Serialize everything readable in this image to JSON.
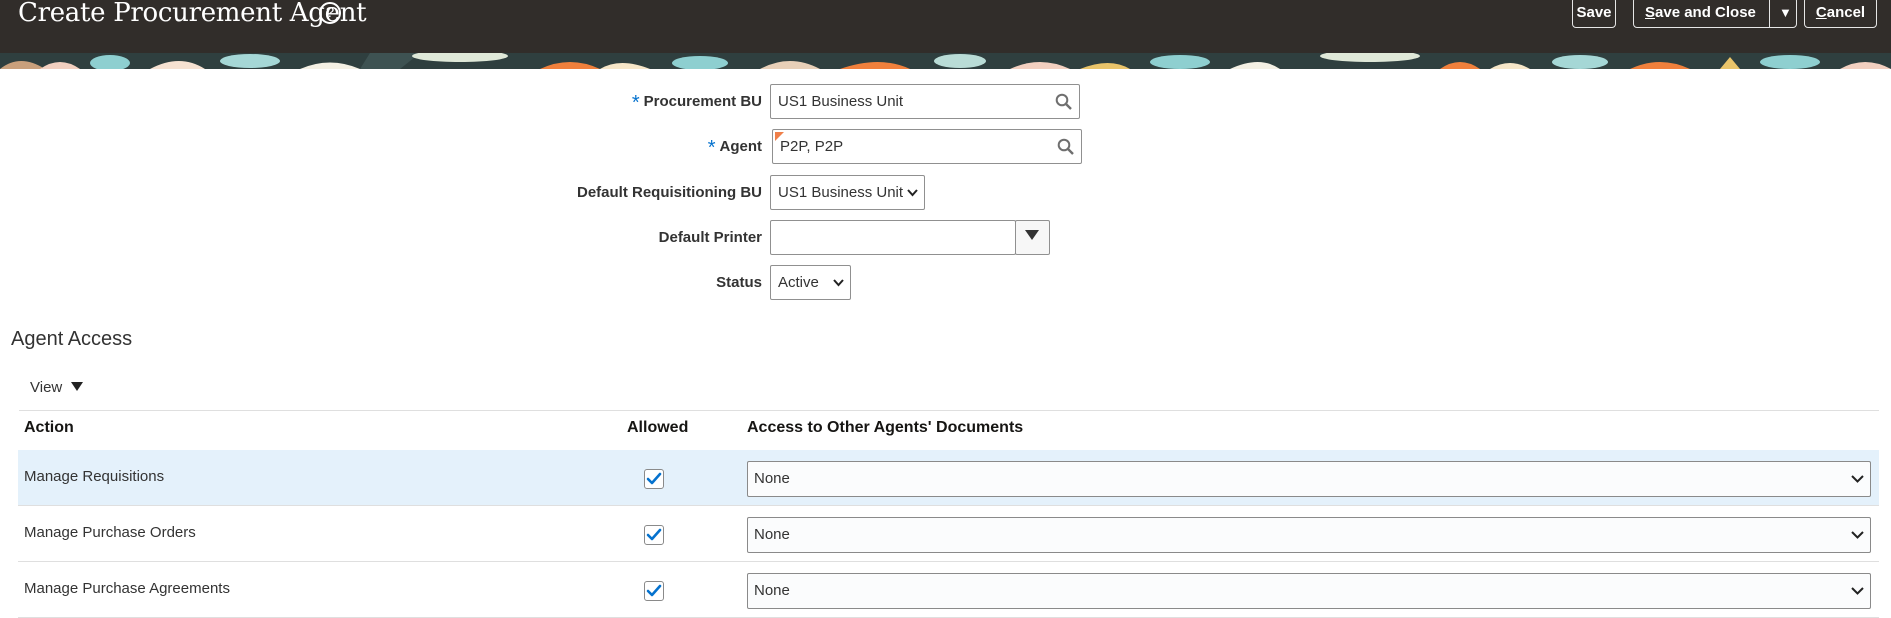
{
  "header": {
    "title": "Create Procurement Agent",
    "help_icon": "help-circle-icon",
    "buttons": {
      "save": "Save",
      "save_and_close_first": "S",
      "save_and_close_rest": "ave and Close",
      "cancel_first": "C",
      "cancel_rest": "ancel"
    },
    "colors": {
      "bar": "#312d2a",
      "text": "#ffffff"
    }
  },
  "form": {
    "procurement_bu": {
      "label": "Procurement BU",
      "value": "US1 Business Unit",
      "required": true
    },
    "agent": {
      "label": "Agent",
      "value": "P2P, P2P",
      "required": true
    },
    "default_requisitioning_bu": {
      "label": "Default Requisitioning BU",
      "value": "US1 Business Unit"
    },
    "default_printer": {
      "label": "Default Printer",
      "value": ""
    },
    "status": {
      "label": "Status",
      "value": "Active"
    },
    "required_marker": "*"
  },
  "agent_access": {
    "title": "Agent Access",
    "view_menu": "View",
    "columns": {
      "action": "Action",
      "allowed": "Allowed",
      "access": "Access to Other Agents' Documents"
    },
    "rows": [
      {
        "action": "Manage Requisitions",
        "allowed": true,
        "access": "None",
        "selected": true
      },
      {
        "action": "Manage Purchase Orders",
        "allowed": true,
        "access": "None",
        "selected": false
      },
      {
        "action": "Manage Purchase Agreements",
        "allowed": true,
        "access": "None",
        "selected": false
      }
    ]
  },
  "colors": {
    "accent": "#0572ce",
    "selected_row": "#e4f1fb"
  }
}
